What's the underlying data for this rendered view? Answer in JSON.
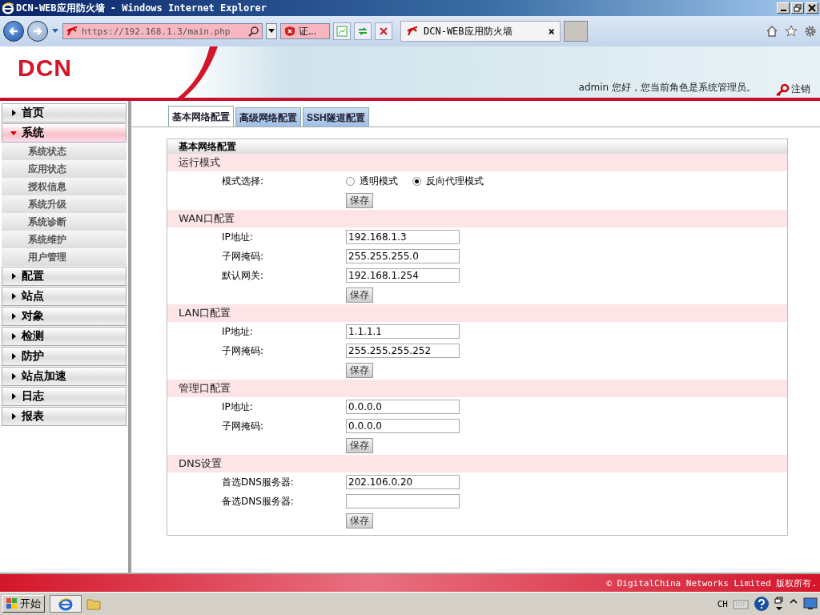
{
  "window": {
    "title": "DCN-WEB应用防火墙 - Windows Internet Explorer"
  },
  "browser": {
    "url": "https://192.168.1.3/main.php",
    "cert_error": "证...",
    "tab": {
      "label": "DCN-WEB应用防火墙",
      "close": "×"
    }
  },
  "header": {
    "logo": "DCN",
    "greeting": "admin 您好，您当前角色是系统管理员。",
    "logout": "注销"
  },
  "sidebar": {
    "items": [
      {
        "label": "首页",
        "expanded": false
      },
      {
        "label": "系统",
        "expanded": true,
        "children": [
          {
            "label": "系统状态"
          },
          {
            "label": "应用状态"
          },
          {
            "label": "授权信息"
          },
          {
            "label": "系统升级"
          },
          {
            "label": "系统诊断"
          },
          {
            "label": "系统维护"
          },
          {
            "label": "用户管理"
          }
        ]
      },
      {
        "label": "配置",
        "expanded": false
      },
      {
        "label": "站点",
        "expanded": false
      },
      {
        "label": "对象",
        "expanded": false
      },
      {
        "label": "检测",
        "expanded": false
      },
      {
        "label": "防护",
        "expanded": false
      },
      {
        "label": "站点加速",
        "expanded": false
      },
      {
        "label": "日志",
        "expanded": false
      },
      {
        "label": "报表",
        "expanded": false
      }
    ]
  },
  "tabs": [
    {
      "label": "基本网络配置",
      "selected": true
    },
    {
      "label": "高级网络配置",
      "selected": false
    },
    {
      "label": "SSH隧道配置",
      "selected": false
    }
  ],
  "panel": {
    "title": "基本网络配置",
    "sections": [
      {
        "title": "运行模式",
        "rows": [
          {
            "kind": "radio",
            "label": "模式选择:",
            "options": [
              {
                "label": "透明模式",
                "selected": false
              },
              {
                "label": "反向代理模式",
                "selected": true
              }
            ]
          }
        ],
        "button": "保存"
      },
      {
        "title": "WAN口配置",
        "rows": [
          {
            "kind": "input",
            "label": "IP地址:",
            "value": "192.168.1.3"
          },
          {
            "kind": "input",
            "label": "子网掩码:",
            "value": "255.255.255.0"
          },
          {
            "kind": "input",
            "label": "默认网关:",
            "value": "192.168.1.254"
          }
        ],
        "button": "保存"
      },
      {
        "title": "LAN口配置",
        "rows": [
          {
            "kind": "input",
            "label": "IP地址:",
            "value": "1.1.1.1"
          },
          {
            "kind": "input",
            "label": "子网掩码:",
            "value": "255.255.255.252"
          }
        ],
        "button": "保存"
      },
      {
        "title": "管理口配置",
        "rows": [
          {
            "kind": "input",
            "label": "IP地址:",
            "value": "0.0.0.0"
          },
          {
            "kind": "input",
            "label": "子网掩码:",
            "value": "0.0.0.0"
          }
        ],
        "button": "保存"
      },
      {
        "title": "DNS设置",
        "rows": [
          {
            "kind": "input",
            "label": "首选DNS服务器:",
            "value": "202.106.0.20"
          },
          {
            "kind": "input",
            "label": "备选DNS服务器:"
          }
        ],
        "button": "保存"
      }
    ]
  },
  "footer": "© DigitalChina Networks Limited 版权所有.",
  "taskbar": {
    "start": "开始",
    "language": "CH"
  }
}
